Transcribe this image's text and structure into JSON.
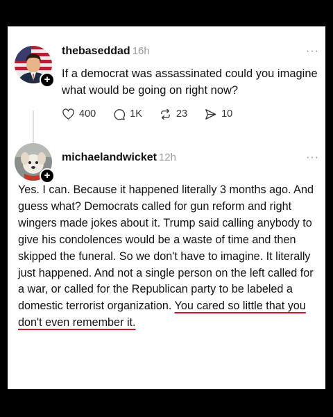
{
  "post1": {
    "username": "thebaseddad",
    "time": "16h",
    "text": "If a democrat was assassinated could you imagine what would be going on right now?",
    "more_label": "···",
    "actions": [
      {
        "icon": "heart-icon",
        "count": "400"
      },
      {
        "icon": "comment-icon",
        "count": "1K"
      },
      {
        "icon": "repost-icon",
        "count": "23"
      },
      {
        "icon": "share-icon",
        "count": "10"
      }
    ]
  },
  "post2": {
    "username": "michaelandwicket",
    "time": "12h",
    "more_label": "···",
    "text_main": "Yes. I can. Because it happened literally 3 months ago. And guess what? Democrats called for gun reform and right wingers made jokes about it. Trump said calling anybody to give his condolences would be a waste of time and then skipped the funeral. So we don't have to imagine. It literally just happened. And not a single person on the left called for a war, or called for the Republican party to be labeled a domestic terrorist organization. ",
    "text_underlined": "You cared so little that you don't even remember it."
  },
  "colors": {
    "background": "#000000",
    "card": "#ffffff",
    "underline": "#d0142c"
  }
}
